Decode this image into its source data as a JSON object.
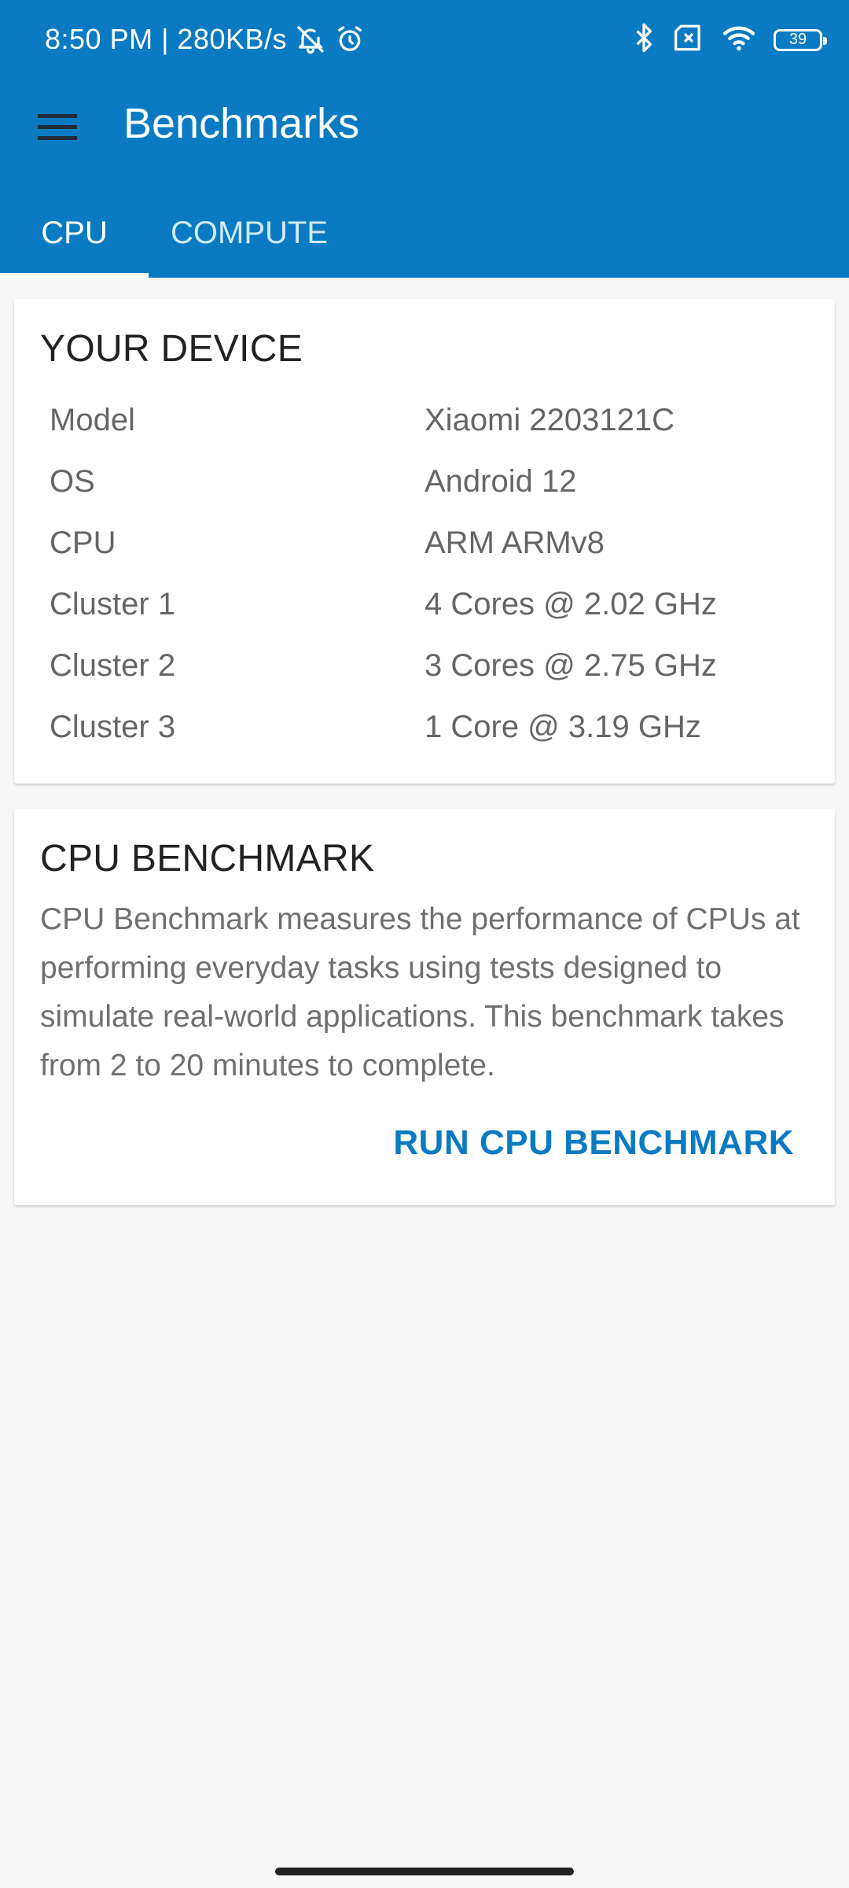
{
  "status_bar": {
    "time": "8:50 PM | 280KB/s",
    "battery": "39",
    "icons": [
      "mute-bell-icon",
      "alarm-icon",
      "bluetooth-icon",
      "no-sim-icon",
      "wifi-icon",
      "battery-icon"
    ]
  },
  "colors": {
    "primary": "#0a7bc2",
    "background": "#f7f7f7",
    "card": "#ffffff"
  },
  "toolbar": {
    "title": "Benchmarks",
    "menu_icon": "hamburger-menu-icon"
  },
  "tabs": [
    {
      "label": "CPU",
      "selected": true
    },
    {
      "label": "COMPUTE",
      "selected": false
    }
  ],
  "device_card": {
    "title": "YOUR DEVICE",
    "rows": [
      {
        "key": "Model",
        "value": "Xiaomi 2203121C"
      },
      {
        "key": "OS",
        "value": "Android 12"
      },
      {
        "key": "CPU",
        "value": "ARM ARMv8"
      },
      {
        "key": "Cluster 1",
        "value": "4 Cores @ 2.02 GHz"
      },
      {
        "key": "Cluster 2",
        "value": "3 Cores @ 2.75 GHz"
      },
      {
        "key": "Cluster 3",
        "value": "1 Core @ 3.19 GHz"
      }
    ]
  },
  "benchmark_card": {
    "title": "CPU BENCHMARK",
    "description": "CPU Benchmark measures the performance of CPUs at performing everyday tasks using tests designed to simulate real-world applications. This benchmark takes from 2 to 20 minutes to complete.",
    "button_label": "RUN CPU BENCHMARK"
  }
}
